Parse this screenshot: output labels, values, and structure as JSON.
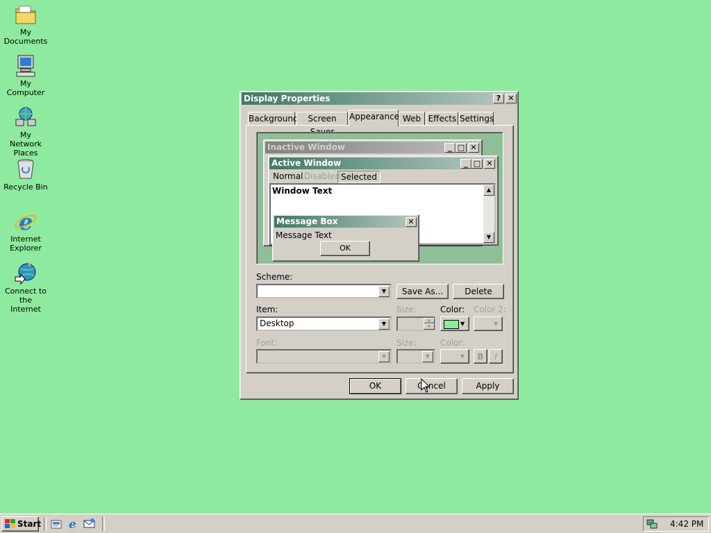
{
  "desktop": {
    "background_color": "#8eea9e",
    "icons": [
      {
        "label": "My Documents",
        "icon": "folder-documents-icon"
      },
      {
        "label": "My Computer",
        "icon": "computer-icon"
      },
      {
        "label": "My Network Places",
        "icon": "network-places-icon"
      },
      {
        "label": "Recycle Bin",
        "icon": "recycle-bin-icon"
      },
      {
        "label": "Internet Explorer",
        "icon": "internet-explorer-icon"
      },
      {
        "label": "Connect to the Internet",
        "icon": "connect-internet-icon"
      }
    ]
  },
  "dialog": {
    "title": "Display Properties",
    "help_btn": "?",
    "close_btn": "✕",
    "tabs": [
      "Background",
      "Screen Saver",
      "Appearance",
      "Web",
      "Effects",
      "Settings"
    ],
    "active_tab": "Appearance",
    "preview": {
      "inactive_title": "Inactive Window",
      "active_title": "Active Window",
      "menu": [
        "Normal",
        "Disabled",
        "Selected"
      ],
      "window_text": "Window Text",
      "msgbox_title": "Message Box",
      "msgbox_text": "Message Text",
      "msgbox_ok": "OK"
    },
    "scheme_label": "Scheme:",
    "scheme_value": "",
    "save_as": "Save As...",
    "delete": "Delete",
    "item_label": "Item:",
    "item_value": "Desktop",
    "size_label": "Size:",
    "color_label": "Color:",
    "color2_label": "Color 2:",
    "font_label": "Font:",
    "size2_label": "Size:",
    "color3_label": "Color:",
    "bold": "B",
    "italic": "I",
    "color_swatch": "#8eea9e",
    "ok": "OK",
    "cancel": "Cancel",
    "apply": "Apply"
  },
  "taskbar": {
    "start": "Start",
    "clock": "4:42 PM"
  }
}
